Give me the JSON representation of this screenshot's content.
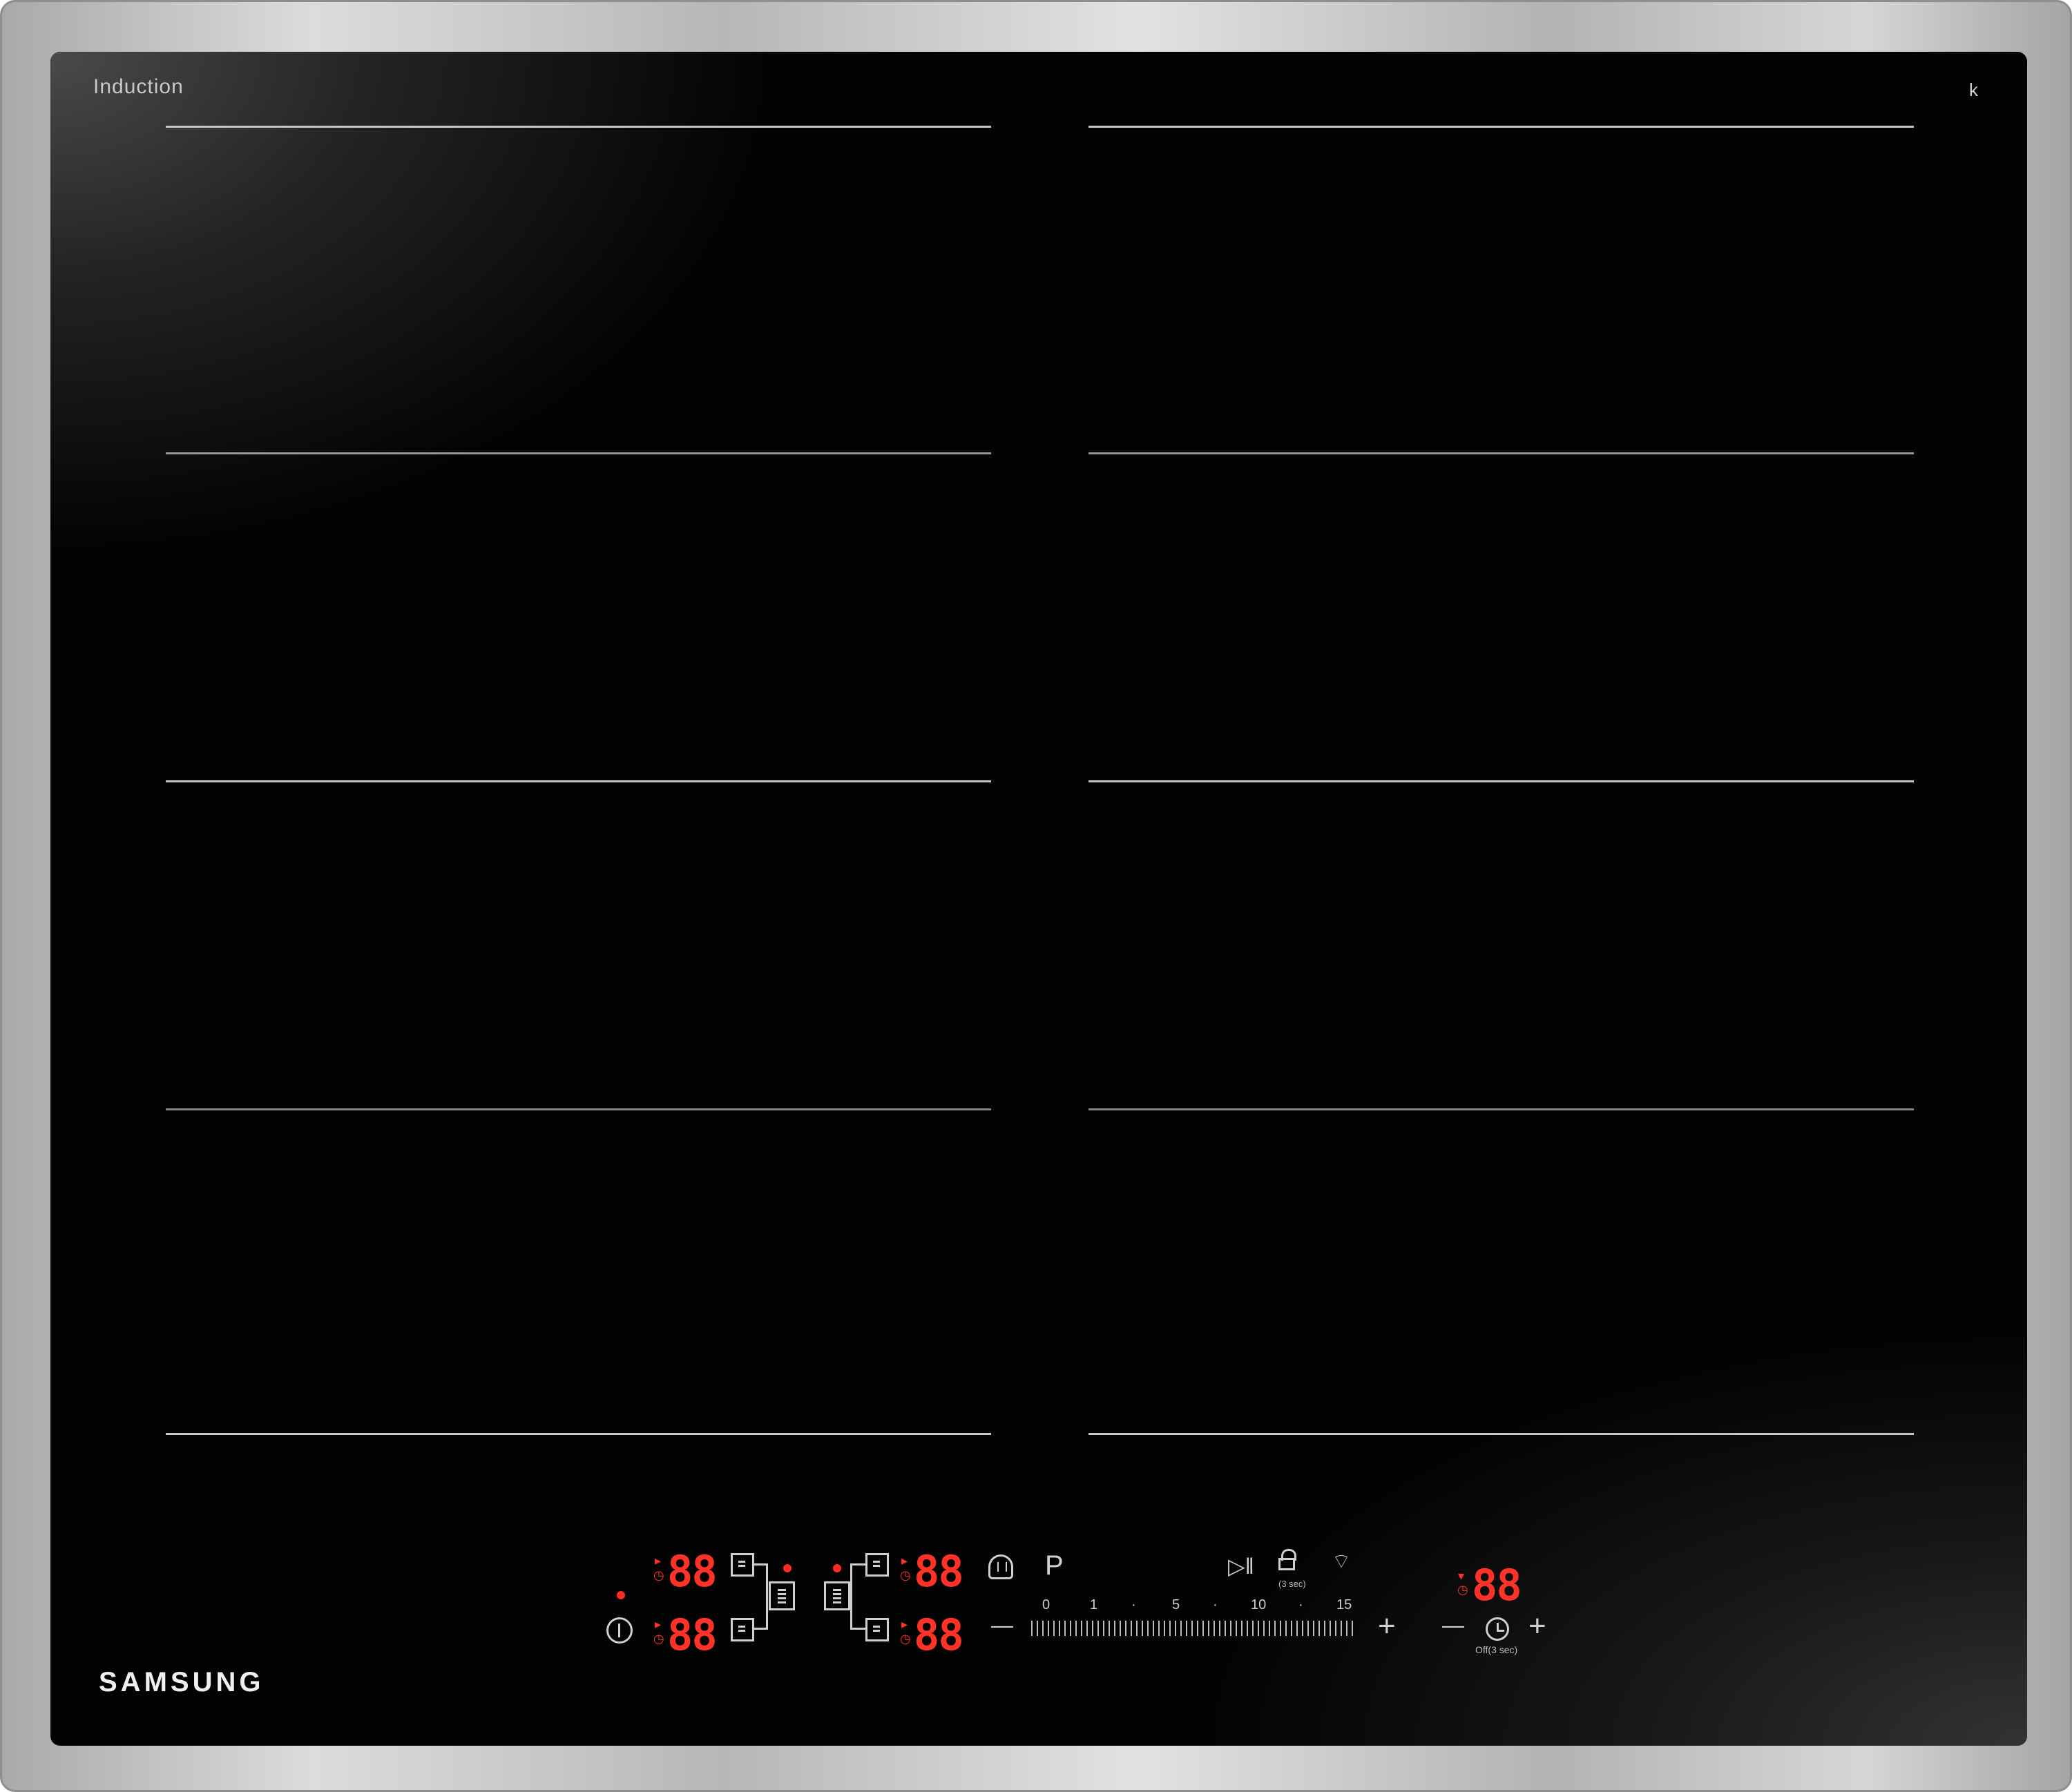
{
  "panel": {
    "label": "Induction",
    "brand": "SAMSUNG",
    "corner_symbol": "k"
  },
  "zones": {
    "count_left": 4,
    "count_right": 4
  },
  "displays": {
    "zone_top_left": "88",
    "zone_bottom_left": "88",
    "zone_top_right": "88",
    "zone_bottom_right": "88",
    "timer": "88"
  },
  "power_button": {
    "icon": "power-icon"
  },
  "controls": {
    "pause_symbol": "▷‖",
    "program_label": "P",
    "lock_caption": "(3 sec)",
    "timer_caption": "Off(3 sec)",
    "minus": "—",
    "plus": "+"
  },
  "power_scale": {
    "labels": [
      "0",
      "1",
      "·",
      "5",
      "·",
      "10",
      "·",
      "15"
    ]
  },
  "colors": {
    "display_red": "#ff3228",
    "glass": "#030303",
    "frame": "#c0c0c0"
  }
}
